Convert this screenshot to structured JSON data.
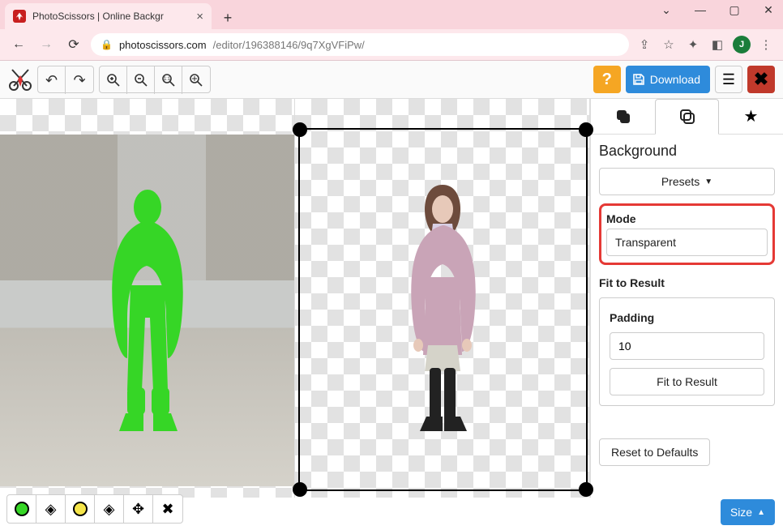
{
  "browser": {
    "tab_title": "PhotoScissors | Online Backgr",
    "url_host": "photoscissors.com",
    "url_path": "/editor/196388146/9q7XgVFiPw/",
    "avatar_letter": "J"
  },
  "toolbar": {
    "download_label": "Download",
    "help_label": "?"
  },
  "panel": {
    "title": "Background",
    "presets_label": "Presets",
    "mode_label": "Mode",
    "mode_value": "Transparent",
    "fit_title": "Fit to Result",
    "padding_label": "Padding",
    "padding_value": "10",
    "fit_button": "Fit to Result",
    "reset_button": "Reset to Defaults"
  },
  "bottom": {
    "size_label": "Size"
  }
}
